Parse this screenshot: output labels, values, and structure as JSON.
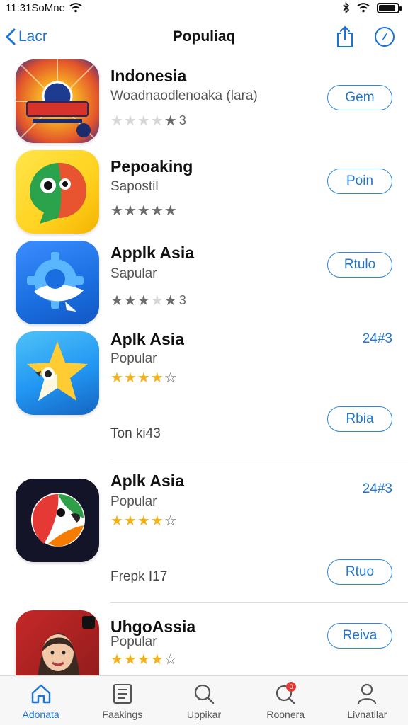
{
  "status_bar": {
    "time": "11:31SoMne",
    "battery_level": 0.9
  },
  "nav": {
    "back_label": "Lacr",
    "title": "Populiaq"
  },
  "apps": [
    {
      "name": "Indonesia",
      "subtitle": "Woadnaodlenoaka (lara)",
      "rating_stars": [
        "light",
        "light",
        "light",
        "light",
        "gray"
      ],
      "rating_text": "3",
      "button": "Gem",
      "price": "",
      "extra": "",
      "icon": "badge-burst-icon",
      "icon_colors": [
        "#f5a623",
        "#e2532b",
        "#3a2c8f"
      ]
    },
    {
      "name": "Pepoaking",
      "subtitle": "Sapostil",
      "rating_stars": [
        "gray",
        "gray",
        "gray",
        "gray",
        "gray"
      ],
      "rating_text": "",
      "button": "Poin",
      "price": "",
      "extra": "",
      "icon": "chat-bird-icon",
      "icon_colors": [
        "#ffd21f",
        "#e8542f",
        "#2ba24c"
      ]
    },
    {
      "name": "Applk Asia",
      "subtitle": "Sapular",
      "rating_stars": [
        "gray",
        "gray",
        "gray",
        "light",
        "gray"
      ],
      "rating_text": "3",
      "button": "Rtulo",
      "price": "",
      "extra": "",
      "icon": "gear-bird-icon",
      "icon_colors": [
        "#1a6ee0",
        "#5ab6ff"
      ]
    },
    {
      "name": "Aplk Asia",
      "subtitle": "Popular",
      "rating_stars": [
        "gold",
        "gold",
        "gold",
        "gold",
        "outline"
      ],
      "rating_text": "",
      "button": "Rbia",
      "price": "24#3",
      "extra": "Ton ki43",
      "icon": "star-bird-icon",
      "icon_colors": [
        "#2196f3",
        "#4fc3f7",
        "#ffcc33"
      ]
    },
    {
      "name": "Aplk Asia",
      "subtitle": "Popular",
      "rating_stars": [
        "gold",
        "gold",
        "gold",
        "gold",
        "outline"
      ],
      "rating_text": "",
      "button": "Rtuo",
      "price": "24#3",
      "extra": "Frepk I17",
      "icon": "parrot-icon",
      "icon_colors": [
        "#141428",
        "#e53935",
        "#2e9e48"
      ]
    },
    {
      "name": "UhgoAssia",
      "subtitle": "Popular",
      "rating_stars": [
        "gold",
        "gold",
        "gold",
        "gold",
        "outline"
      ],
      "rating_text": "",
      "button": "Reiva",
      "price": "",
      "extra": "",
      "icon": "portrait-icon",
      "icon_colors": [
        "#c62828",
        "#3b2a22",
        "#f2c9a8"
      ]
    }
  ],
  "tabs": [
    {
      "label": "Adonata",
      "icon": "home-icon",
      "active": true
    },
    {
      "label": "Faakings",
      "icon": "list-icon",
      "active": false
    },
    {
      "label": "Uppikar",
      "icon": "search-icon",
      "active": false
    },
    {
      "label": "Roonera",
      "icon": "chat-search-icon",
      "active": false,
      "badge": "0"
    },
    {
      "label": "Livnatilar",
      "icon": "person-icon",
      "active": false
    }
  ],
  "colors": {
    "accent": "#1a73d9",
    "star_gold": "#f3b21b"
  }
}
